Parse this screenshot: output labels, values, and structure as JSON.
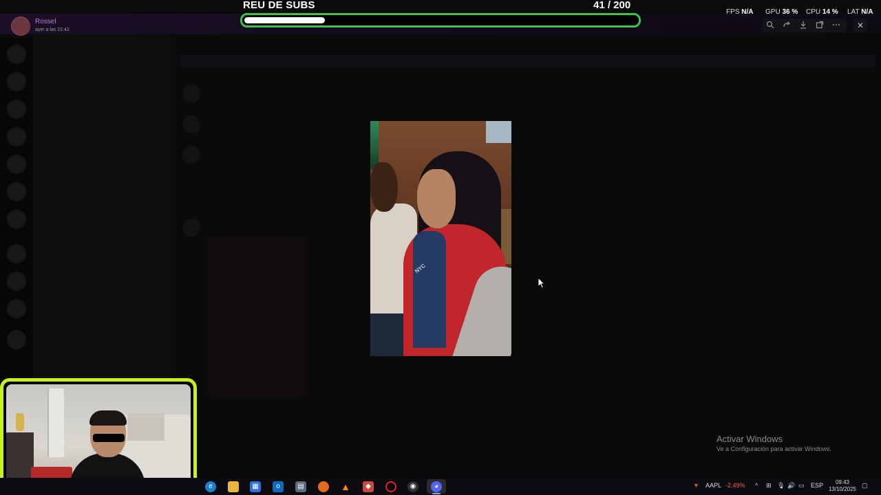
{
  "notification": {
    "name": "Rossel",
    "time": "ayer a las 22:42"
  },
  "subs_goal": {
    "title": "REU DE SUBS",
    "current": 41,
    "goal": 200,
    "count_text": "41  / 200",
    "progress_fraction": 0.205,
    "bar_color": "#3fc34a"
  },
  "stats": {
    "fps_label": "FPS",
    "fps_value": "N/A",
    "gpu_label": "GPU",
    "gpu_value": "36 %",
    "cpu_label": "CPU",
    "cpu_value": "14 %",
    "lat_label": "LAT",
    "lat_value": "N/A"
  },
  "viewer_toolbar": {
    "icons": [
      "zoom-icon",
      "forward-icon",
      "download-icon",
      "open-external-icon",
      "more-icon"
    ],
    "close_icon": "close-icon"
  },
  "photo": {
    "shirt_text": "NYC"
  },
  "webcam": {
    "border_color": "#c6f21a"
  },
  "windows_activation": {
    "title": "Activar Windows",
    "subtitle": "Ve a Configuración para activar Windows."
  },
  "taskbar": {
    "apps": [
      "edge-icon",
      "file-explorer-icon",
      "store-icon",
      "outlook-icon",
      "photos-icon",
      "firefox-icon",
      "vlc-icon",
      "git-icon",
      "opera-icon",
      "obs-icon",
      "discord-icon"
    ],
    "stock_ticker": "AAPL",
    "stock_change": "-2.49%",
    "stock_change_color": "#ff5b5b",
    "language": "ESP",
    "time": "09:43",
    "date": "13/10/2025"
  }
}
